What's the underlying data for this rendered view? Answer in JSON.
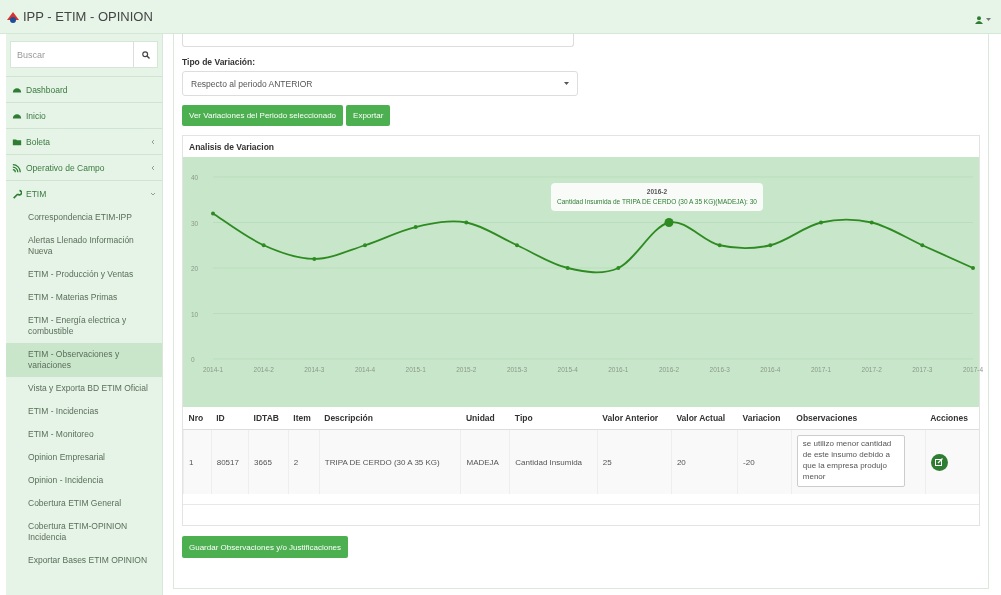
{
  "app": {
    "title": "IPP - ETIM - OPINION"
  },
  "sidebar": {
    "search": {
      "placeholder": "Buscar"
    },
    "items": [
      {
        "label": "Dashboard"
      },
      {
        "label": "Inicio"
      },
      {
        "label": "Boleta",
        "expanded": false
      },
      {
        "label": "Operativo de Campo",
        "expanded": false
      },
      {
        "label": "ETIM",
        "expanded": true,
        "children": [
          {
            "label": "Correspondencia ETIM-IPP",
            "selected": false
          },
          {
            "label": "Alertas Llenado Información Nueva",
            "selected": false
          },
          {
            "label": "ETIM - Producción y Ventas",
            "selected": false
          },
          {
            "label": "ETIM - Materias Primas",
            "selected": false
          },
          {
            "label": "ETIM - Energía electrica y combustible",
            "selected": false
          },
          {
            "label": "ETIM - Observaciones y variaciones",
            "selected": true
          },
          {
            "label": "Vista y Exporta BD ETIM Oficial",
            "selected": false
          },
          {
            "label": "ETIM - Incidencias",
            "selected": false
          },
          {
            "label": "ETIM - Monitoreo",
            "selected": false
          },
          {
            "label": "Opinion Empresarial",
            "selected": false
          },
          {
            "label": "Opinion - Incidencia",
            "selected": false
          },
          {
            "label": "Cobertura ETIM General",
            "selected": false
          },
          {
            "label": "Cobertura ETIM-OPINION Incidencia",
            "selected": false
          },
          {
            "label": "Exportar Bases ETIM OPINION",
            "selected": false
          }
        ]
      }
    ]
  },
  "form": {
    "variation_label": "Tipo de Variación:",
    "variation_value": "Respecto al periodo ANTERIOR",
    "buttons": [
      "Ver Variaciones del Periodo seleccionado",
      "Exportar"
    ]
  },
  "analysis": {
    "title": "Analisis de Variacion",
    "chart_data": {
      "type": "line",
      "categories": [
        "2014-1",
        "2014-2",
        "2014-3",
        "2014-4",
        "2015-1",
        "2015-2",
        "2015-3",
        "2015-4",
        "2016-1",
        "2016-2",
        "2016-3",
        "2016-4",
        "2017-1",
        "2017-2",
        "2017-3",
        "2017-4"
      ],
      "grid": true,
      "series": [
        {
          "color": "#2e8b22",
          "values": [
            32,
            25,
            22,
            25,
            29,
            30,
            25,
            20,
            20,
            30,
            25,
            25,
            30,
            30,
            25,
            20
          ]
        }
      ],
      "ylim": [
        0,
        40
      ],
      "yticks": [
        0,
        10,
        20,
        30,
        40
      ]
    },
    "highlight": [
      false,
      false,
      false,
      false,
      false,
      false,
      false,
      false,
      false,
      true,
      false,
      false,
      false,
      false,
      false,
      false
    ],
    "tooltip": {
      "title": "2016-2",
      "text": "Cantidad Insumida de TRIPA DE CERDO (30 A 35 KG)(MADEJA): 30"
    },
    "table": {
      "columns": [
        "Nro",
        "ID",
        "IDTAB",
        "Item",
        "Descripción",
        "Unidad",
        "Tipo",
        "Valor Anterior",
        "Valor Actual",
        "Variacion",
        "Observaciones",
        "Acciones"
      ],
      "rows": [
        {
          "cells": [
            "1",
            "80517",
            "3665",
            "2",
            "TRIPA DE CERDO (30 A 35 KG)",
            "MADEJA",
            "Cantidad Insumida",
            "25",
            "20",
            "-20"
          ],
          "observation": "se utilizo menor cantidad de este insumo debido a que la empresa produjo menor"
        }
      ]
    }
  },
  "save_button": "Guardar Observaciones y/o Justificaciones"
}
